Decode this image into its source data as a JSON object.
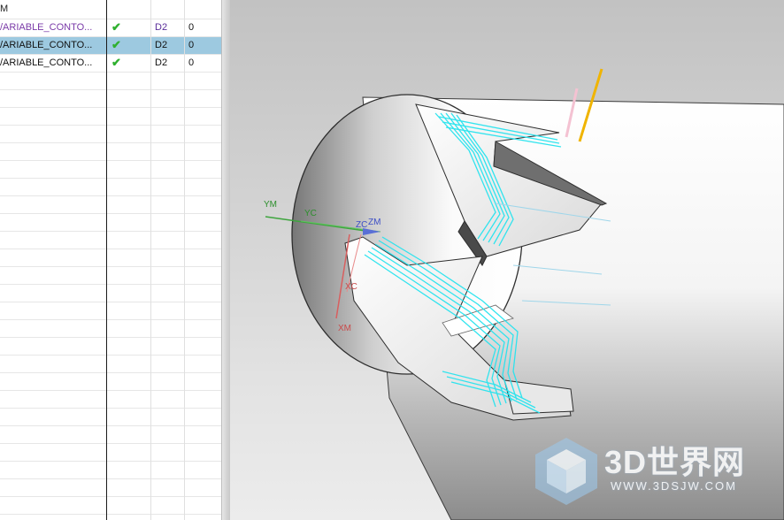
{
  "navigator": {
    "header_label": "M",
    "operations": [
      {
        "name": "/ARIABLE_CONTO...",
        "status": "✔",
        "tool": "D2",
        "value": "0",
        "selected": false,
        "color": "purple"
      },
      {
        "name": "/ARIABLE_CONTO...",
        "status": "✔",
        "tool": "D2",
        "value": "0",
        "selected": true,
        "color": "black"
      },
      {
        "name": "/ARIABLE_CONTO...",
        "status": "✔",
        "tool": "D2",
        "value": "0",
        "selected": false,
        "color": "black"
      }
    ]
  },
  "triad": {
    "ym": "YM",
    "yc": "YC",
    "zc": "ZC",
    "zm": "ZM",
    "xc": "XC",
    "xm": "XM"
  },
  "watermark": {
    "brand": "3D世界网",
    "url": "WWW.3DSJW.COM"
  },
  "colors": {
    "toolpath": "#27e3ee",
    "selection": "#9dc9e0",
    "tool_axis": "#f0b400",
    "check": "#2fb02f"
  }
}
